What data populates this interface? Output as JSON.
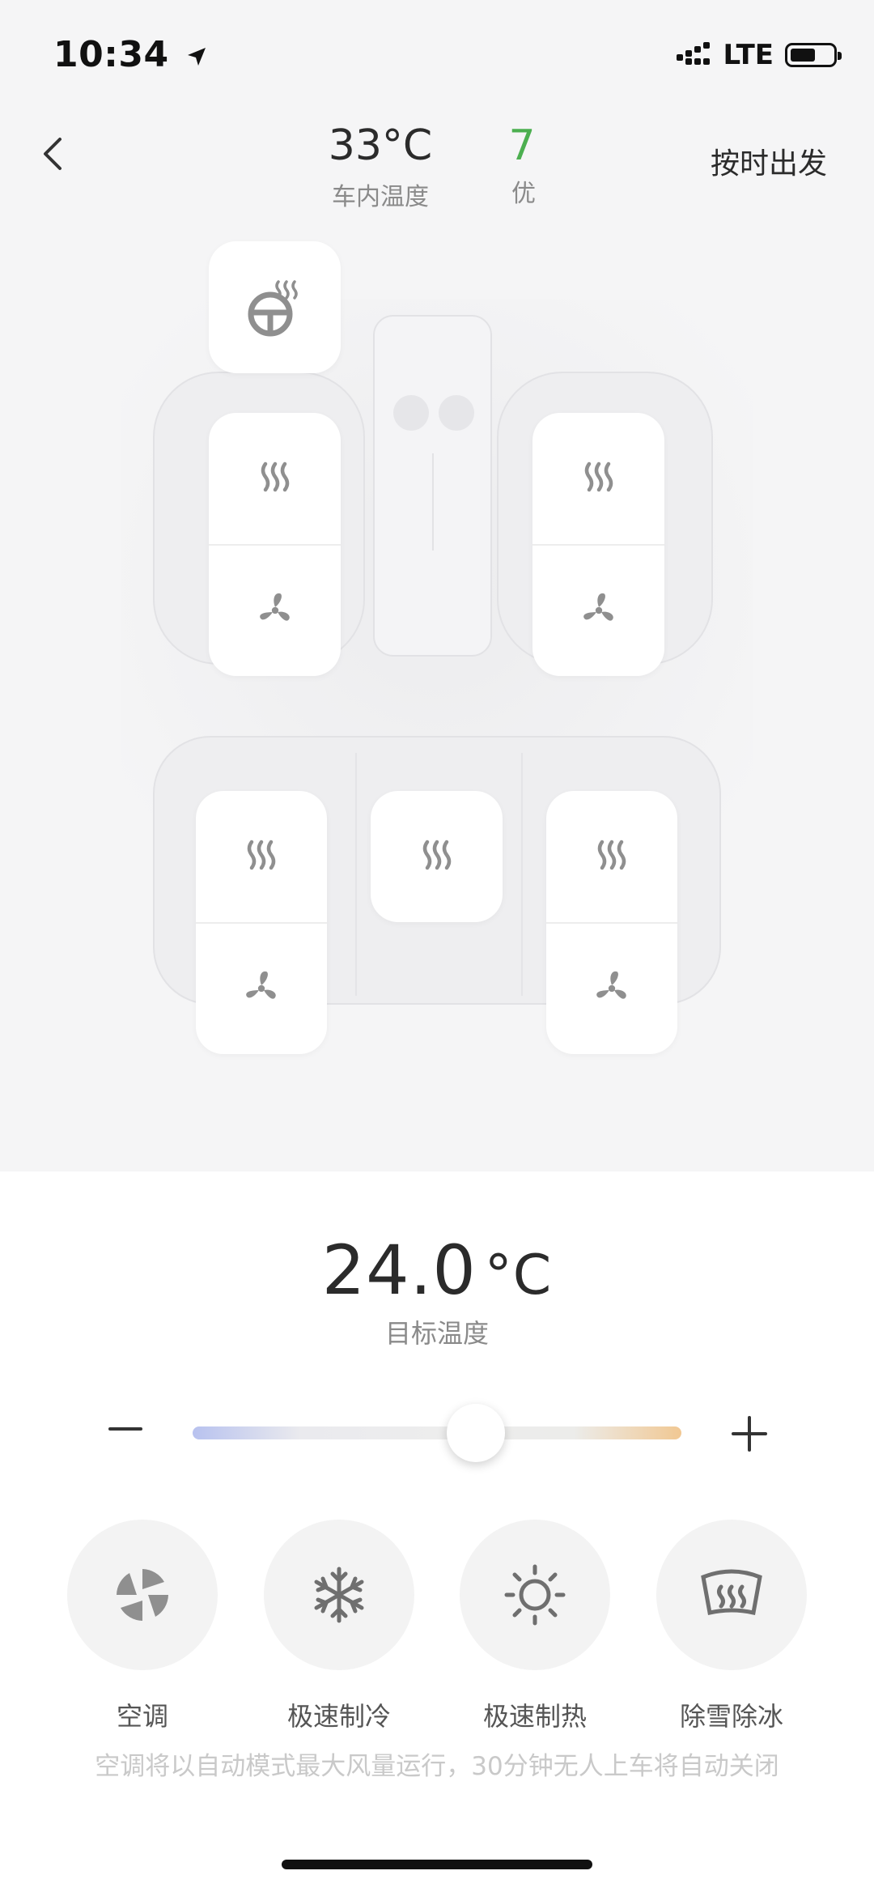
{
  "status_bar": {
    "time": "10:34",
    "network": "LTE"
  },
  "header": {
    "cabin_temp": "33°C",
    "cabin_temp_label": "车内温度",
    "aqi_value": "7",
    "aqi_label": "优",
    "schedule_label": "按时出发"
  },
  "seats": {
    "steering_wheel_heat_icon": "steering-wheel-heat-icon",
    "heat_icon": "seat-heat-icon",
    "vent_icon": "seat-vent-icon"
  },
  "climate": {
    "target_temp": "24.0",
    "unit": "°C",
    "target_label": "目标温度",
    "slider_level": 0.58,
    "colors": {
      "cold": "#b8c2ef",
      "hot": "#f1c893"
    }
  },
  "modes": [
    {
      "label": "空调",
      "icon": "ac-fan-icon"
    },
    {
      "label": "极速制冷",
      "icon": "snowflake-icon"
    },
    {
      "label": "极速制热",
      "icon": "sun-icon"
    },
    {
      "label": "除雪除冰",
      "icon": "defrost-icon"
    }
  ],
  "note": "空调将以自动模式最大风量运行，30分钟无人上车将自动关闭"
}
